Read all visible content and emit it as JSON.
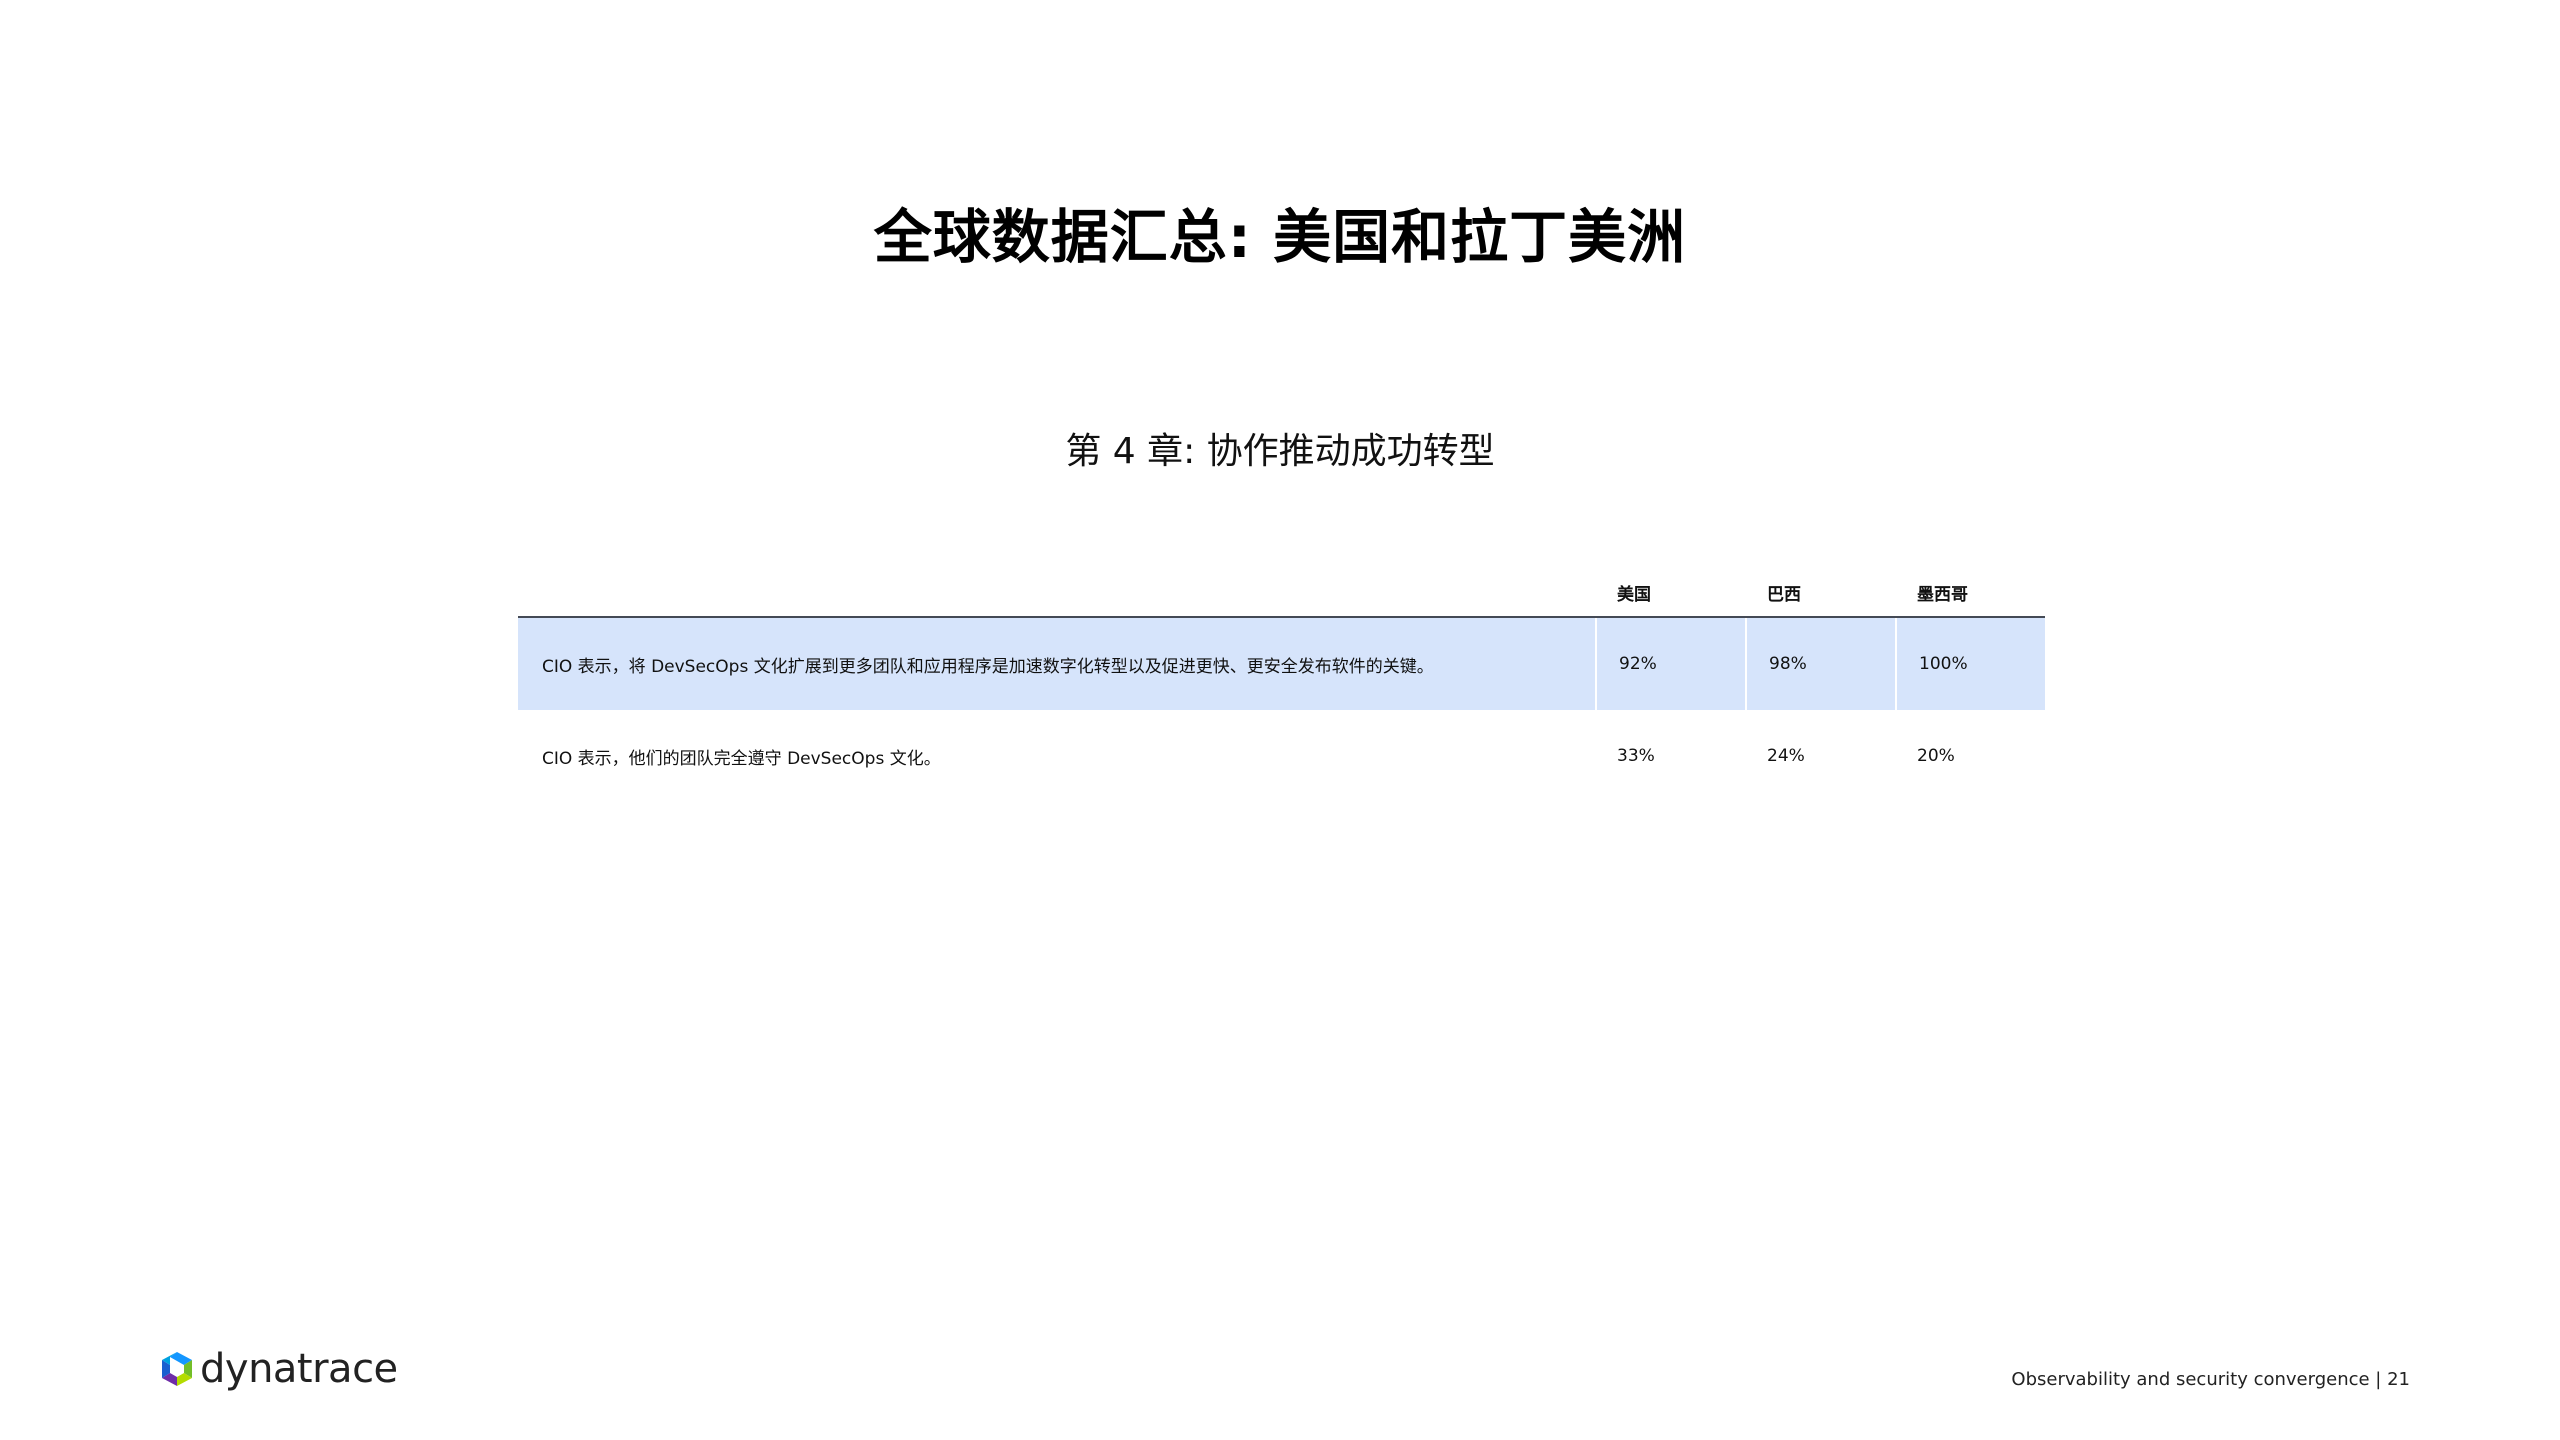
{
  "page": {
    "title": "全球数据汇总: 美国和拉丁美洲",
    "subtitle": "第 4 章: 协作推动成功转型"
  },
  "table": {
    "headers": [
      "",
      "美国",
      "巴西",
      "墨西哥"
    ],
    "rows": [
      {
        "label": "CIO 表示，将 DevSecOps 文化扩展到更多团队和应用程序是加速数字化转型以及促进更快、更安全发布软件的关键。",
        "values": [
          "92%",
          "98%",
          "100%"
        ],
        "highlight": true
      },
      {
        "label": "CIO 表示，他们的团队完全遵守 DevSecOps 文化。",
        "values": [
          "33%",
          "24%",
          "20%"
        ],
        "highlight": false
      }
    ],
    "colors": {
      "highlight_row": "#d6e4fb",
      "header_rule": "#444a55"
    }
  },
  "brand": {
    "logo_text": "dynatrace",
    "logo_icon": "dynatrace-cube-icon",
    "colors": [
      "#73be28",
      "#1496ff",
      "#6f2da8",
      "#b4dc00"
    ]
  },
  "footer": {
    "text": "Observability and security convergence | 21"
  }
}
